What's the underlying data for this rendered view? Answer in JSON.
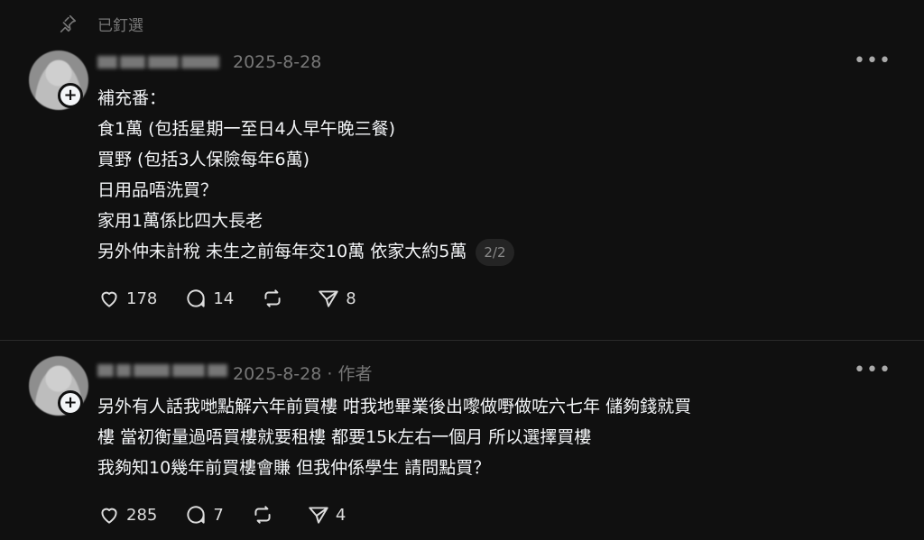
{
  "pinned": {
    "label": "已釘選"
  },
  "posts": [
    {
      "date": "2025-8-28",
      "author_tag": "",
      "lines": [
        "補充番：",
        "食1萬 (包括星期一至日4人早午晚三餐)",
        "買野 (包括3人保險每年6萬)",
        "日用品唔洗買？",
        "家用1萬係比四大長老",
        "另外仲未計稅 未生之前每年交10萬 依家大約5萬"
      ],
      "page_badge": "2/2",
      "likes": "178",
      "replies": "14",
      "shares": "8"
    },
    {
      "date": "2025-8-28",
      "author_tag": "· 作者",
      "lines": [
        "另外￼有人話我哋點解六年前買樓 咁我地畢業後出嚟做嘢做咗六七年 儲夠錢就買",
        "樓 當初￼衡量過唔買樓就要租樓 都要15k左右一個月 所以選擇買樓",
        "我夠知10幾年前買樓會賺 但我仲係學生 請問點買？"
      ],
      "likes": "285",
      "replies": "7",
      "shares": "4"
    }
  ]
}
